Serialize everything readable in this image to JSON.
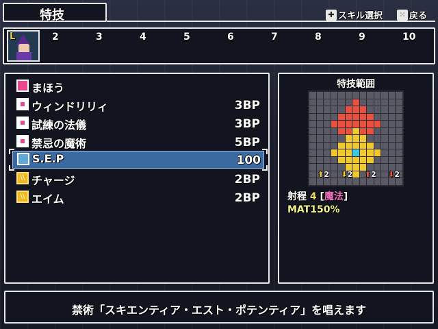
{
  "header": {
    "title": "特技",
    "hint_select_label": "スキル選択",
    "hint_back_label": "戻る"
  },
  "party": {
    "slots": [
      "2",
      "3",
      "4",
      "5",
      "6",
      "7",
      "8",
      "9",
      "10"
    ],
    "leader_badge": "L"
  },
  "skills": [
    {
      "name": "まほう",
      "cost": "",
      "icon": "magic-category"
    },
    {
      "name": "ウィンドリリィ",
      "cost": "3BP",
      "icon": "magic"
    },
    {
      "name": "試練の法儀",
      "cost": "3BP",
      "icon": "magic"
    },
    {
      "name": "禁忌の魔術",
      "cost": "5BP",
      "icon": "magic"
    },
    {
      "name": "S.E.P",
      "cost": "100",
      "icon": "special",
      "selected": true
    },
    {
      "name": "チャージ",
      "cost": "2BP",
      "icon": "skill"
    },
    {
      "name": "エイム",
      "cost": "2BP",
      "icon": "skill"
    }
  ],
  "range_panel": {
    "title": "特技範囲",
    "buff_values": [
      "2",
      "2",
      "2",
      "2"
    ],
    "range_label": "射程",
    "range_value": "4",
    "range_type_open": "[",
    "range_type": "魔法",
    "range_type_close": "]",
    "scaling": "MAT150%"
  },
  "description": "禁術「スキエンティア・エスト・ポテンティア」を唱えます",
  "colors": {
    "selection": "#3b6aa0",
    "range_red": "#e85040",
    "range_yellow": "#f0c830",
    "center": "#40c8e0",
    "type_pink": "#f070c0"
  }
}
